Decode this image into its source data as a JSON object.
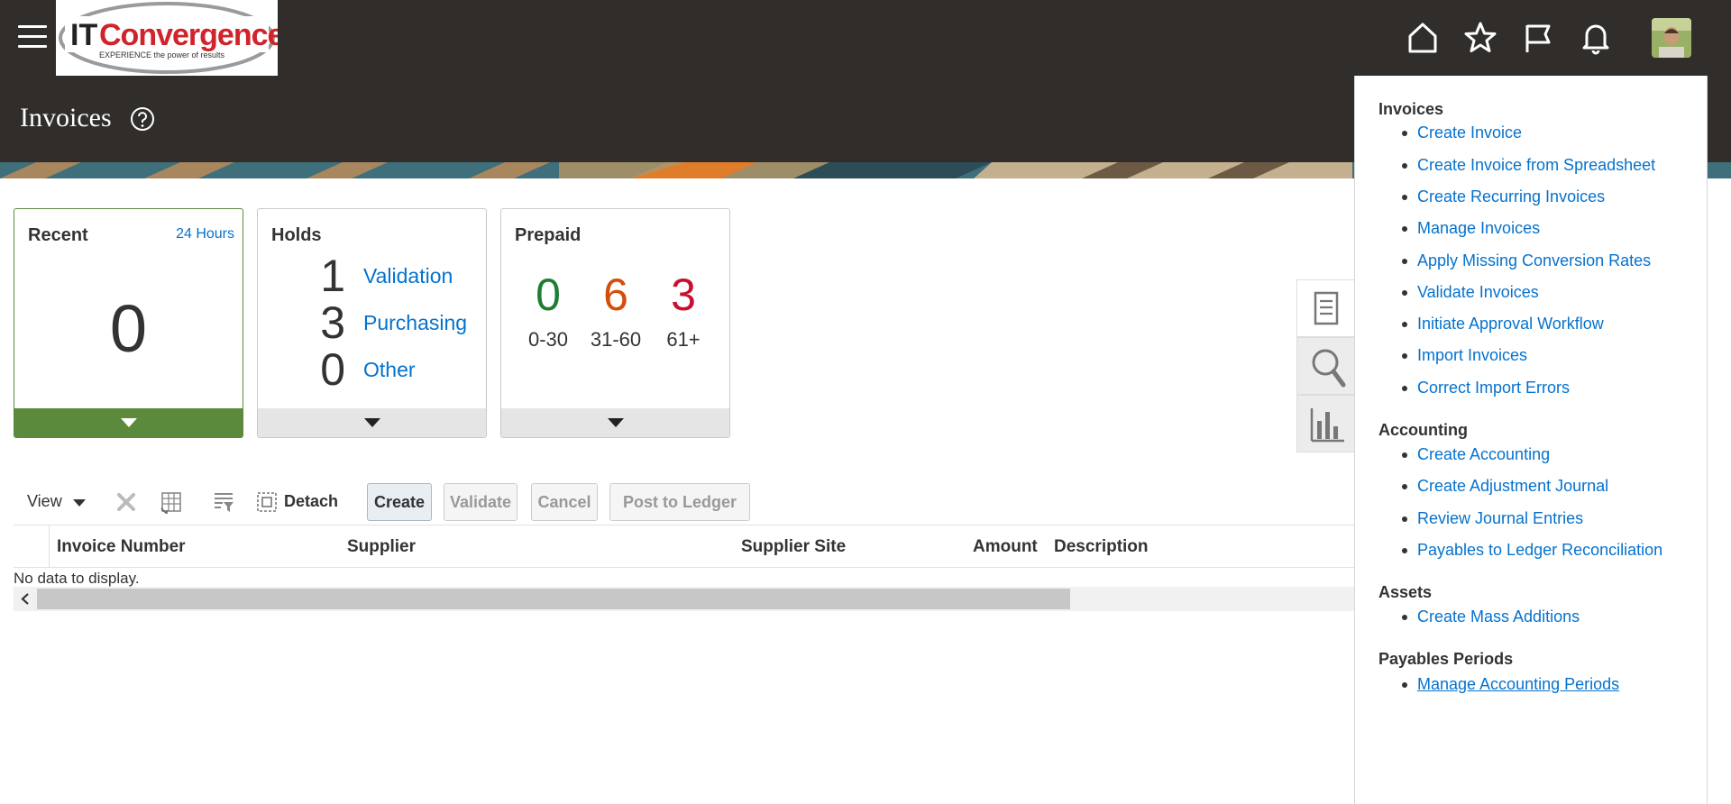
{
  "header": {
    "menu_icon": "hamburger-icon",
    "logo": {
      "brand_it": "IT",
      "brand_name": "Convergence",
      "tagline": "EXPERIENCE the power of results"
    },
    "icons": [
      "home-icon",
      "star-icon",
      "flag-icon",
      "bell-icon"
    ],
    "avatar": "user-avatar"
  },
  "page": {
    "title": "Invoices",
    "help_icon": "help-icon"
  },
  "tiles": {
    "recent": {
      "title": "Recent",
      "subtitle": "24 Hours",
      "value": "0"
    },
    "holds": {
      "title": "Holds",
      "rows": [
        {
          "count": "1",
          "label": "Validation"
        },
        {
          "count": "3",
          "label": "Purchasing"
        },
        {
          "count": "0",
          "label": "Other"
        }
      ]
    },
    "prepaid": {
      "title": "Prepaid",
      "buckets": [
        {
          "count": "0",
          "label": "0-30",
          "color": "#1e7d32"
        },
        {
          "count": "6",
          "label": "31-60",
          "color": "#d44d0c"
        },
        {
          "count": "3",
          "label": "61+",
          "color": "#c8102e"
        }
      ]
    }
  },
  "toolbar": {
    "view_label": "View",
    "detach_label": "Detach",
    "create_label": "Create",
    "validate_label": "Validate",
    "cancel_label": "Cancel",
    "post_label": "Post to Ledger"
  },
  "table": {
    "columns": [
      "Invoice Number",
      "Supplier",
      "Supplier Site",
      "Amount",
      "Description"
    ],
    "empty_message": "No data to display."
  },
  "drawer_tabs": [
    "tasks-icon",
    "search-icon",
    "reports-icon"
  ],
  "task_panel": {
    "groups": [
      {
        "title": "Invoices",
        "items": [
          "Create Invoice",
          "Create Invoice from Spreadsheet",
          "Create Recurring Invoices",
          "Manage Invoices",
          "Apply Missing Conversion Rates",
          "Validate Invoices",
          "Initiate Approval Workflow",
          "Import Invoices",
          "Correct Import Errors"
        ]
      },
      {
        "title": "Accounting",
        "items": [
          "Create Accounting",
          "Create Adjustment Journal",
          "Review Journal Entries",
          "Payables to Ledger Reconciliation"
        ]
      },
      {
        "title": "Assets",
        "items": [
          "Create Mass Additions"
        ]
      },
      {
        "title": "Payables Periods",
        "items": [
          "Manage Accounting Periods"
        ]
      }
    ]
  }
}
